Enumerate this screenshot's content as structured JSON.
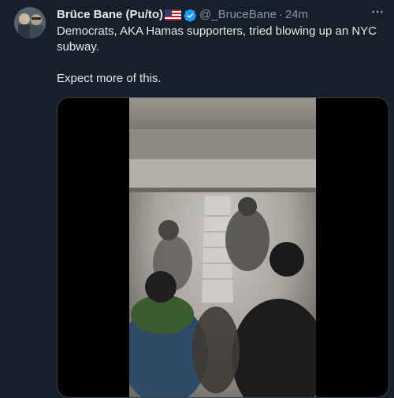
{
  "tweet": {
    "author": {
      "display_name": "Brüce Bane (Pu/to)",
      "flag": "us-flag-icon",
      "verified": true,
      "handle": "@_BruceBane",
      "separator": "·",
      "timestamp": "24m"
    },
    "text_lines": [
      "Democrats, AKA Hamas supporters, tried blowing up an NYC subway.",
      "Expect more of this."
    ],
    "more_icon": "more-horizontal-icon",
    "media": {
      "kind": "video"
    }
  },
  "colors": {
    "background": "#15202b",
    "text_primary": "#e7e9ea",
    "text_secondary": "#8b98a5",
    "verified_blue": "#1d9bf0",
    "border": "#38444d"
  }
}
